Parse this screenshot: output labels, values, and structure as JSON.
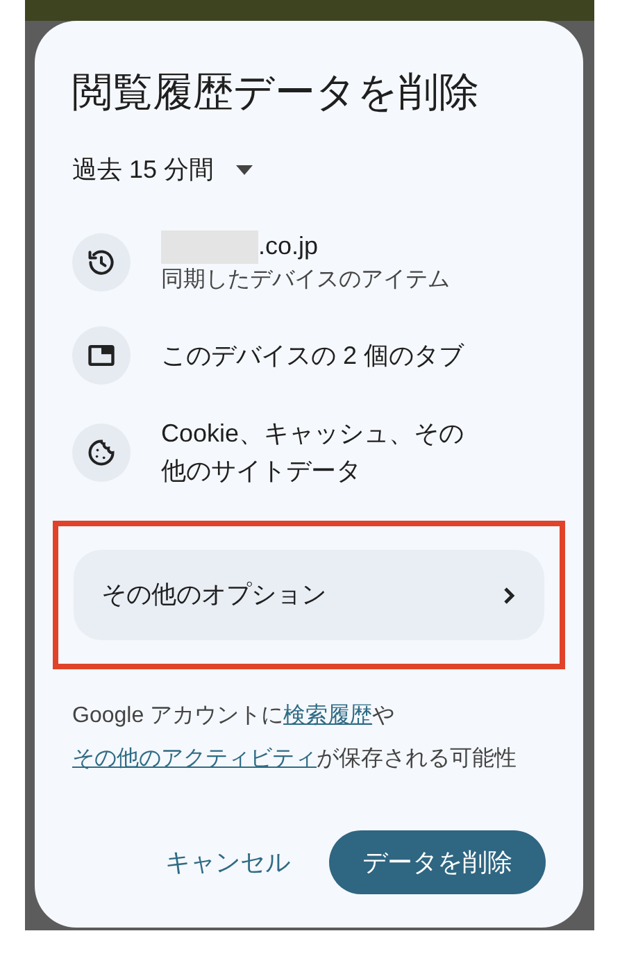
{
  "dialog": {
    "title": "閲覧履歴データを削除",
    "time_range": {
      "value": "過去 15 分間"
    },
    "items": [
      {
        "kind": "history",
        "redacted": true,
        "title": ".co.jp",
        "subtitle": "同期したデバイスのアイテム"
      },
      {
        "kind": "tabs",
        "title": "このデバイスの 2 個のタブ"
      },
      {
        "kind": "cookie",
        "title": "Cookie、キャッシュ、その他のサイトデータ"
      }
    ],
    "more_options": {
      "label": "その他のオプション",
      "highlighted": true
    },
    "notice": {
      "before": "Google アカウントに",
      "link_1": "検索履歴",
      "middle": "や",
      "link_2": "その他のアクティビティ",
      "after": "が保存される可能性"
    },
    "buttons": {
      "cancel": "キャンセル",
      "confirm": "データを削除"
    }
  }
}
